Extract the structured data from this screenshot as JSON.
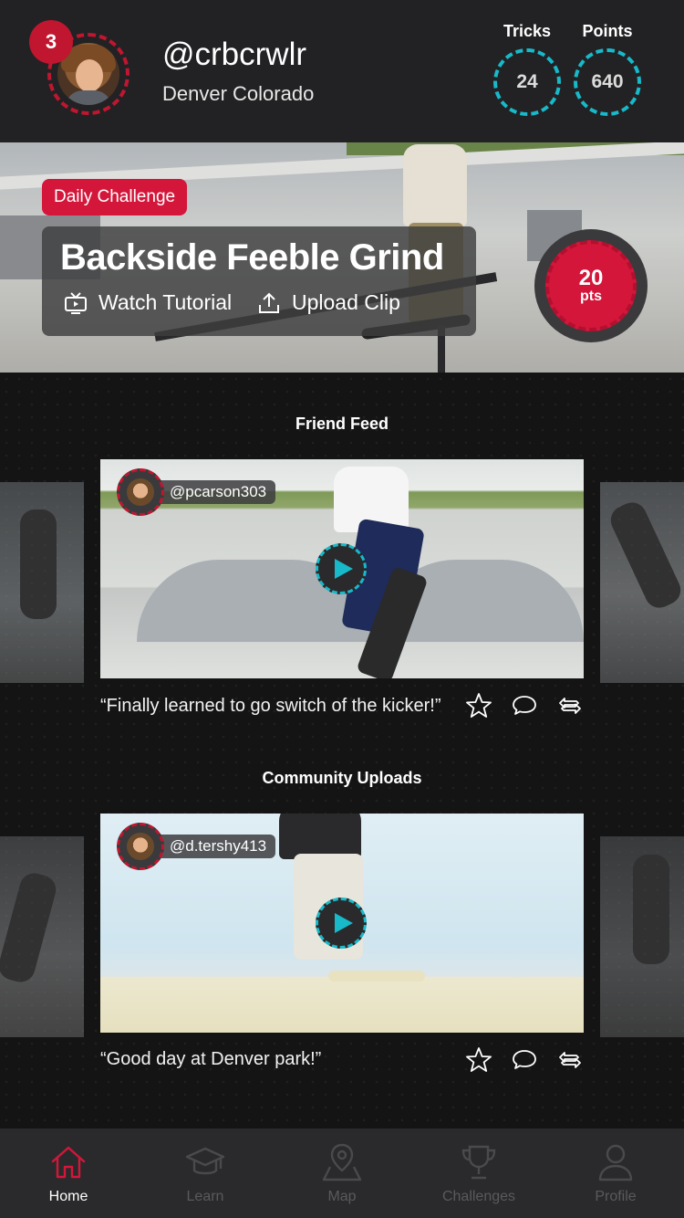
{
  "header": {
    "level": "3",
    "username": "@crbcrwlr",
    "location": "Denver Colorado",
    "stats": [
      {
        "label": "Tricks",
        "value": "24"
      },
      {
        "label": "Points",
        "value": "640"
      }
    ]
  },
  "challenge": {
    "chip": "Daily Challenge",
    "title": "Backside Feeble Grind",
    "watch_label": "Watch Tutorial",
    "upload_label": "Upload Clip",
    "points_value": "20",
    "points_unit": "pts"
  },
  "friend_feed": {
    "title": "Friend Feed",
    "post": {
      "user": "@pcarson303",
      "caption": "“Finally  learned to go switch of the kicker!”"
    }
  },
  "community": {
    "title": "Community Uploads",
    "post": {
      "user": "@d.tershy413",
      "caption": "“Good day at Denver park!”"
    }
  },
  "tabbar": {
    "items": [
      {
        "label": "Home",
        "icon": "home-icon",
        "active": true
      },
      {
        "label": "Learn",
        "icon": "graduation-cap-icon",
        "active": false
      },
      {
        "label": "Map",
        "icon": "map-pin-icon",
        "active": false
      },
      {
        "label": "Challenges",
        "icon": "trophy-icon",
        "active": false
      },
      {
        "label": "Profile",
        "icon": "person-icon",
        "active": false
      }
    ]
  },
  "colors": {
    "accent_red": "#d3163a",
    "accent_cyan": "#18b9c9",
    "background": "#141414"
  }
}
